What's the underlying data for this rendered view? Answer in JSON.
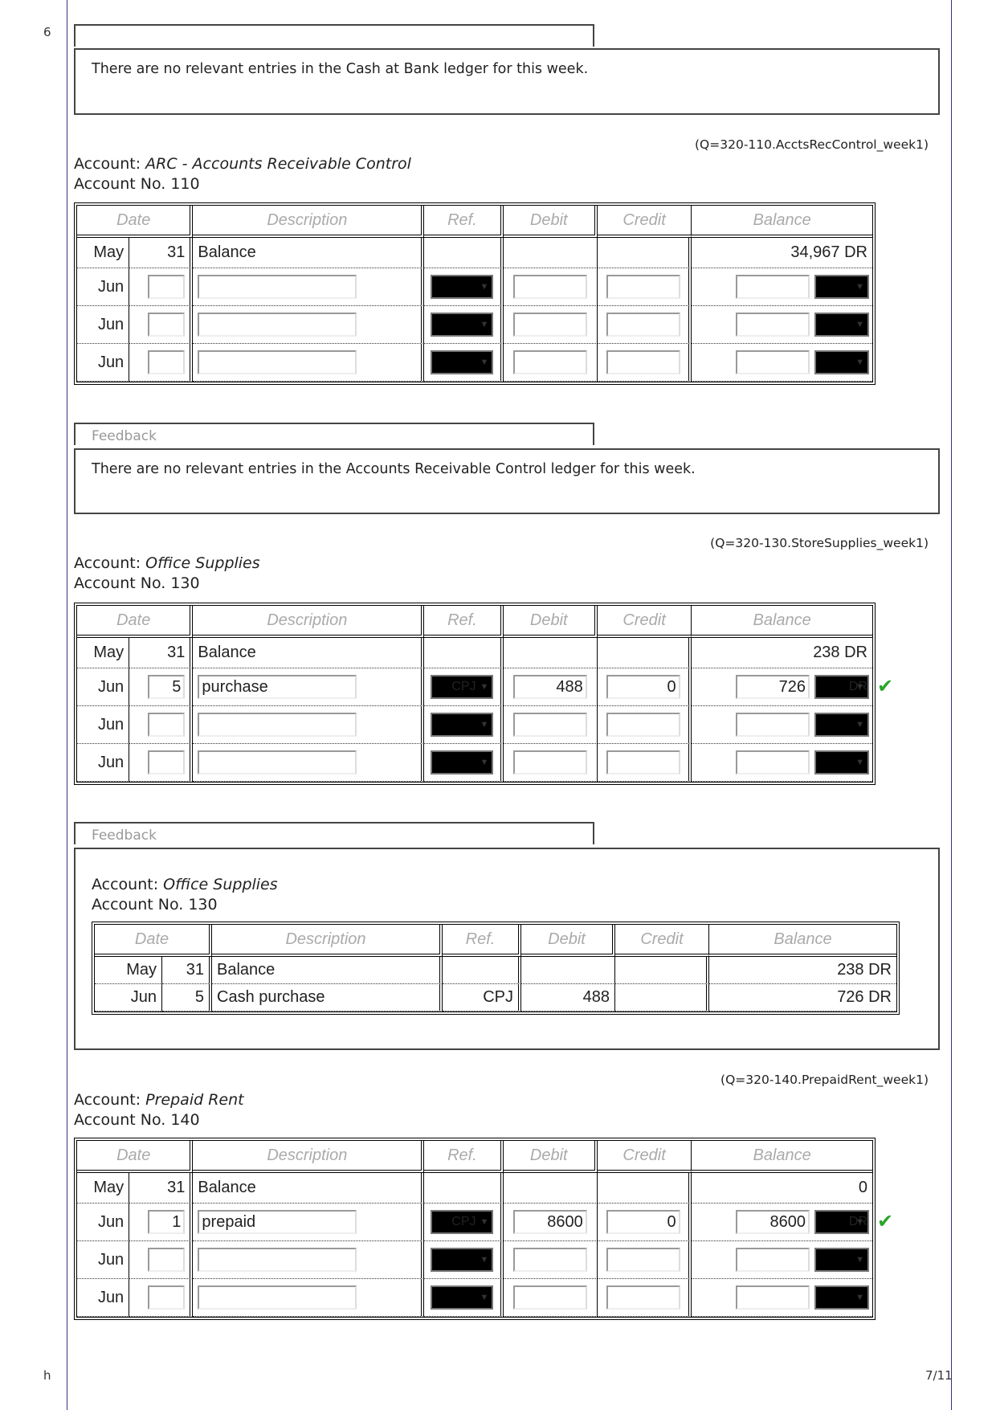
{
  "page": {
    "left_marker": "6",
    "bottom_left_marker": "h",
    "page_number": "7/11"
  },
  "columns": [
    "Date",
    "Description",
    "Ref.",
    "Debit",
    "Credit",
    "Balance"
  ],
  "feedback_label": "Feedback",
  "feedback_cash": {
    "label": "",
    "text": "There are no relevant entries in the Cash at Bank ledger for this week."
  },
  "ledgers": [
    {
      "qid": "(Q=320-110.AcctsRecControl_week1)",
      "account_prefix": "Account: ",
      "account_name": "ARC - Accounts Receivable Control",
      "account_no": "Account No. 110",
      "opening": {
        "month": "May",
        "day": "31",
        "description": "Balance",
        "balance": "34,967 DR"
      },
      "entries": [
        {
          "month": "Jun",
          "day": "",
          "description": "",
          "ref": "",
          "debit": "",
          "credit": "",
          "balance": "",
          "side": "",
          "correct": false
        },
        {
          "month": "Jun",
          "day": "",
          "description": "",
          "ref": "",
          "debit": "",
          "credit": "",
          "balance": "",
          "side": "",
          "correct": false
        },
        {
          "month": "Jun",
          "day": "",
          "description": "",
          "ref": "",
          "debit": "",
          "credit": "",
          "balance": "",
          "side": "",
          "correct": false
        }
      ],
      "feedback": {
        "text": "There are no relevant entries in the Accounts Receivable Control ledger for this week."
      }
    },
    {
      "qid": "(Q=320-130.StoreSupplies_week1)",
      "account_prefix": "Account: ",
      "account_name": "Office Supplies",
      "account_no": "Account No. 130",
      "opening": {
        "month": "May",
        "day": "31",
        "description": "Balance",
        "balance": "238 DR"
      },
      "entries": [
        {
          "month": "Jun",
          "day": "5",
          "description": "purchase",
          "ref": "CPJ",
          "debit": "488",
          "credit": "0",
          "balance": "726",
          "side": "DR",
          "correct": true
        },
        {
          "month": "Jun",
          "day": "",
          "description": "",
          "ref": "",
          "debit": "",
          "credit": "",
          "balance": "",
          "side": "",
          "correct": false
        },
        {
          "month": "Jun",
          "day": "",
          "description": "",
          "ref": "",
          "debit": "",
          "credit": "",
          "balance": "",
          "side": "",
          "correct": false
        }
      ],
      "feedback": {
        "account_prefix": "Account: ",
        "account_name": "Office Supplies",
        "account_no": "Account No. 130",
        "rows": [
          {
            "month": "May",
            "day": "31",
            "description": "Balance",
            "ref": "",
            "debit": "",
            "credit": "",
            "balance": "238 DR"
          },
          {
            "month": "Jun",
            "day": "5",
            "description": "Cash purchase",
            "ref": "CPJ",
            "debit": "488",
            "credit": "",
            "balance": "726 DR"
          }
        ]
      }
    },
    {
      "qid": "(Q=320-140.PrepaidRent_week1)",
      "account_prefix": "Account: ",
      "account_name": "Prepaid Rent",
      "account_no": "Account No. 140",
      "opening": {
        "month": "May",
        "day": "31",
        "description": "Balance",
        "balance": "0"
      },
      "entries": [
        {
          "month": "Jun",
          "day": "1",
          "description": "prepaid",
          "ref": "CPJ",
          "debit": "8600",
          "credit": "0",
          "balance": "8600",
          "side": "DR",
          "correct": true
        },
        {
          "month": "Jun",
          "day": "",
          "description": "",
          "ref": "",
          "debit": "",
          "credit": "",
          "balance": "",
          "side": "",
          "correct": false
        },
        {
          "month": "Jun",
          "day": "",
          "description": "",
          "ref": "",
          "debit": "",
          "credit": "",
          "balance": "",
          "side": "",
          "correct": false
        }
      ]
    }
  ],
  "colors": {
    "check": "#2aa52a",
    "frame_line": "#33337a",
    "header_text": "#aaaaaa"
  }
}
